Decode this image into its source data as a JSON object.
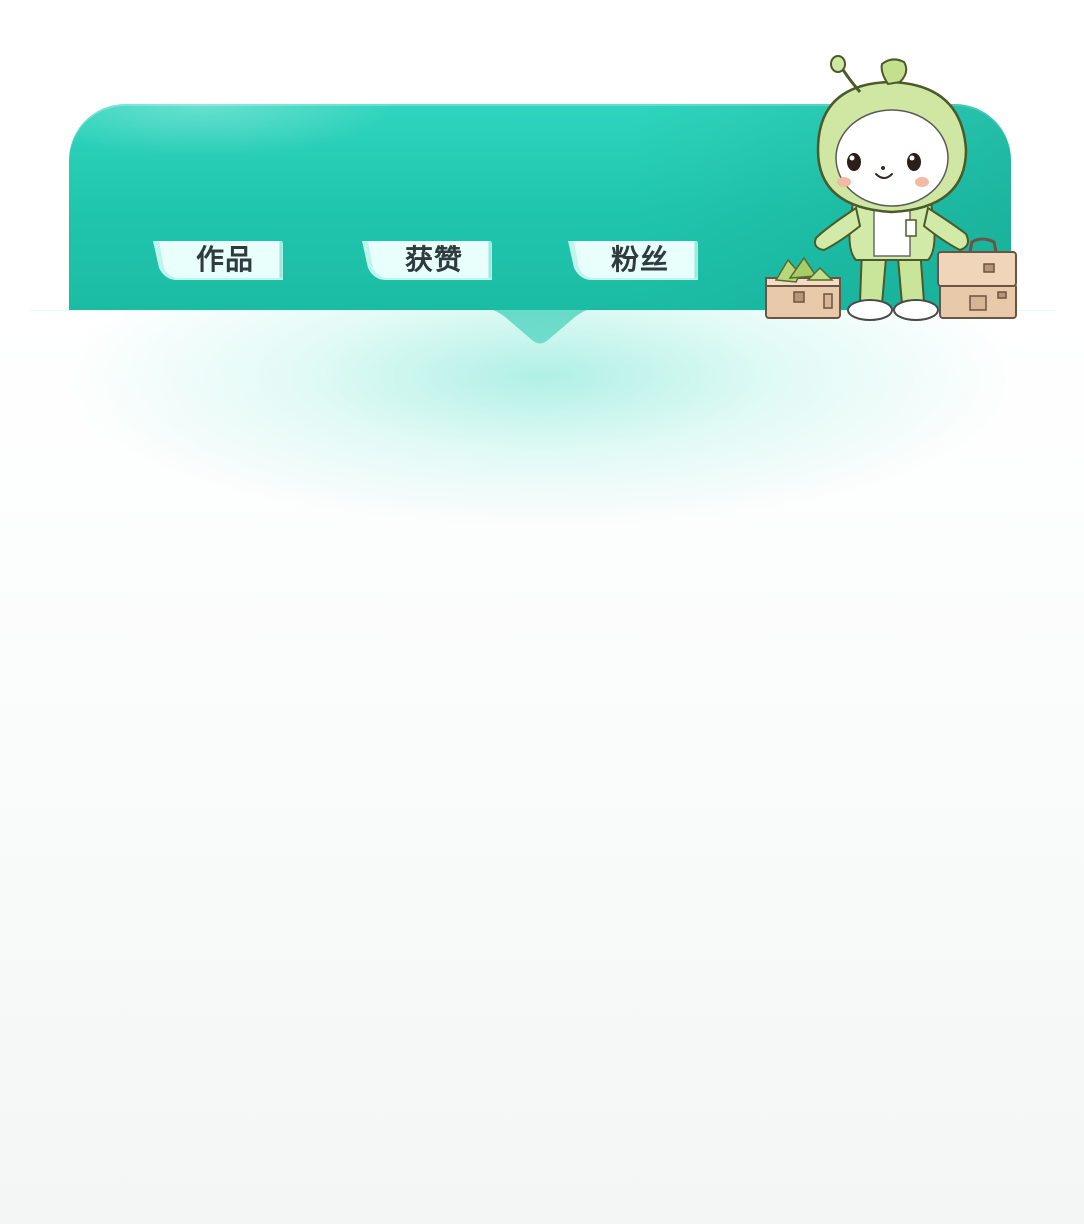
{
  "tabs": [
    {
      "label": "作品"
    },
    {
      "label": "获赞"
    },
    {
      "label": "粉丝"
    }
  ],
  "mascot": {
    "icon": "bean-sprout-mascot-icon"
  },
  "colors": {
    "header_teal": "#20c5ad",
    "tab_fill": "#e6fffb",
    "tab_text": "#2f3b3e",
    "panel_bg": "#f6f8f8"
  }
}
